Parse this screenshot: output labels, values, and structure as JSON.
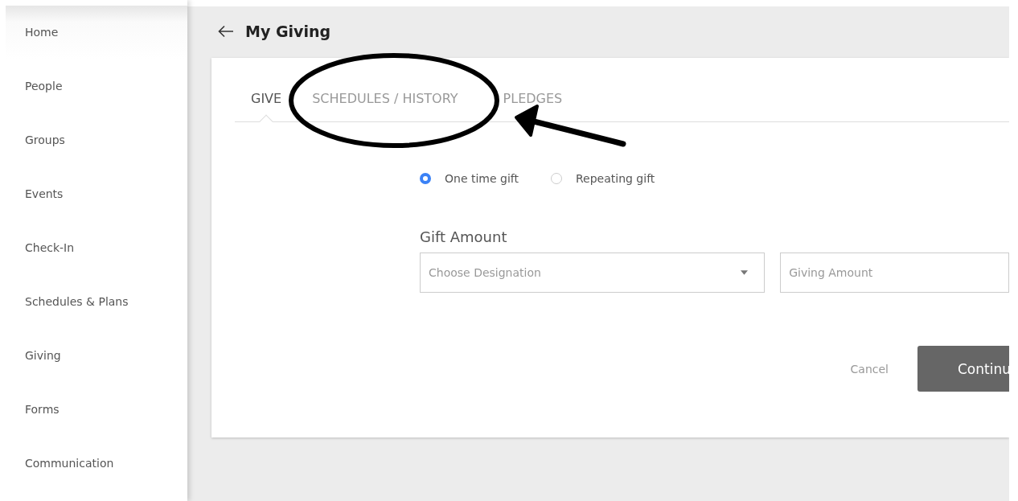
{
  "sidebar": {
    "items": [
      {
        "label": "Home",
        "selected": true
      },
      {
        "label": "People",
        "selected": false
      },
      {
        "label": "Groups",
        "selected": false
      },
      {
        "label": "Events",
        "selected": false
      },
      {
        "label": "Check-In",
        "selected": false
      },
      {
        "label": "Schedules & Plans",
        "selected": false
      },
      {
        "label": "Giving",
        "selected": false
      },
      {
        "label": "Forms",
        "selected": false
      },
      {
        "label": "Communication",
        "selected": false
      }
    ]
  },
  "header": {
    "title": "My Giving"
  },
  "tabs": [
    {
      "label": "GIVE",
      "selected": true
    },
    {
      "label": "SCHEDULES / HISTORY",
      "selected": false
    },
    {
      "label": "PLEDGES",
      "selected": false
    }
  ],
  "gift_type": [
    {
      "label": "One time gift",
      "selected": true
    },
    {
      "label": "Repeating gift",
      "selected": false
    }
  ],
  "gift_amount": {
    "label": "Gift Amount",
    "designation": {
      "placeholder": "Choose Designation"
    },
    "amount": {
      "placeholder": "Giving Amount"
    }
  },
  "buttons": {
    "cancel": "Cancel",
    "continue": "Continu"
  }
}
